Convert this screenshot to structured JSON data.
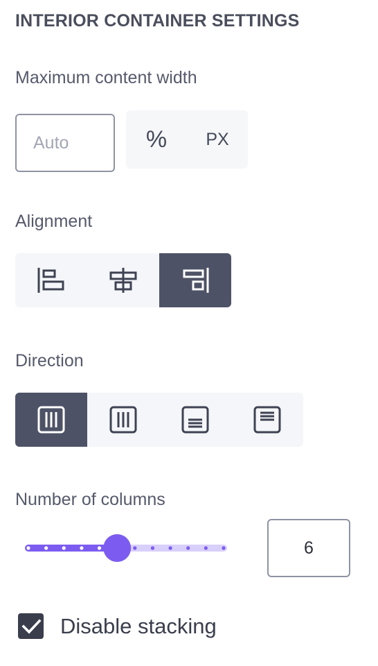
{
  "section_title": "INTERIOR CONTAINER SETTINGS",
  "max_width": {
    "label": "Maximum content width",
    "placeholder": "Auto",
    "value": "",
    "units": [
      {
        "label": "%",
        "selected": false
      },
      {
        "label": "PX",
        "selected": false
      }
    ]
  },
  "alignment": {
    "label": "Alignment",
    "options": [
      {
        "icon": "align-left-icon",
        "selected": false
      },
      {
        "icon": "align-center-icon",
        "selected": false
      },
      {
        "icon": "align-right-icon",
        "selected": true
      }
    ]
  },
  "direction": {
    "label": "Direction",
    "options": [
      {
        "icon": "columns-left-to-right-icon",
        "selected": true
      },
      {
        "icon": "columns-right-to-left-icon",
        "selected": false
      },
      {
        "icon": "rows-top-to-bottom-icon",
        "selected": false
      },
      {
        "icon": "rows-bottom-to-top-icon",
        "selected": false
      }
    ]
  },
  "columns": {
    "label": "Number of columns",
    "value": "6",
    "min": 1,
    "max": 12,
    "slider_value": 6
  },
  "disable_stacking": {
    "label": "Disable stacking",
    "checked": true
  },
  "colors": {
    "accent": "#7c5cf0",
    "accent_light": "#d9cffb",
    "active_segment": "#4e5266",
    "text": "#4b5062"
  }
}
